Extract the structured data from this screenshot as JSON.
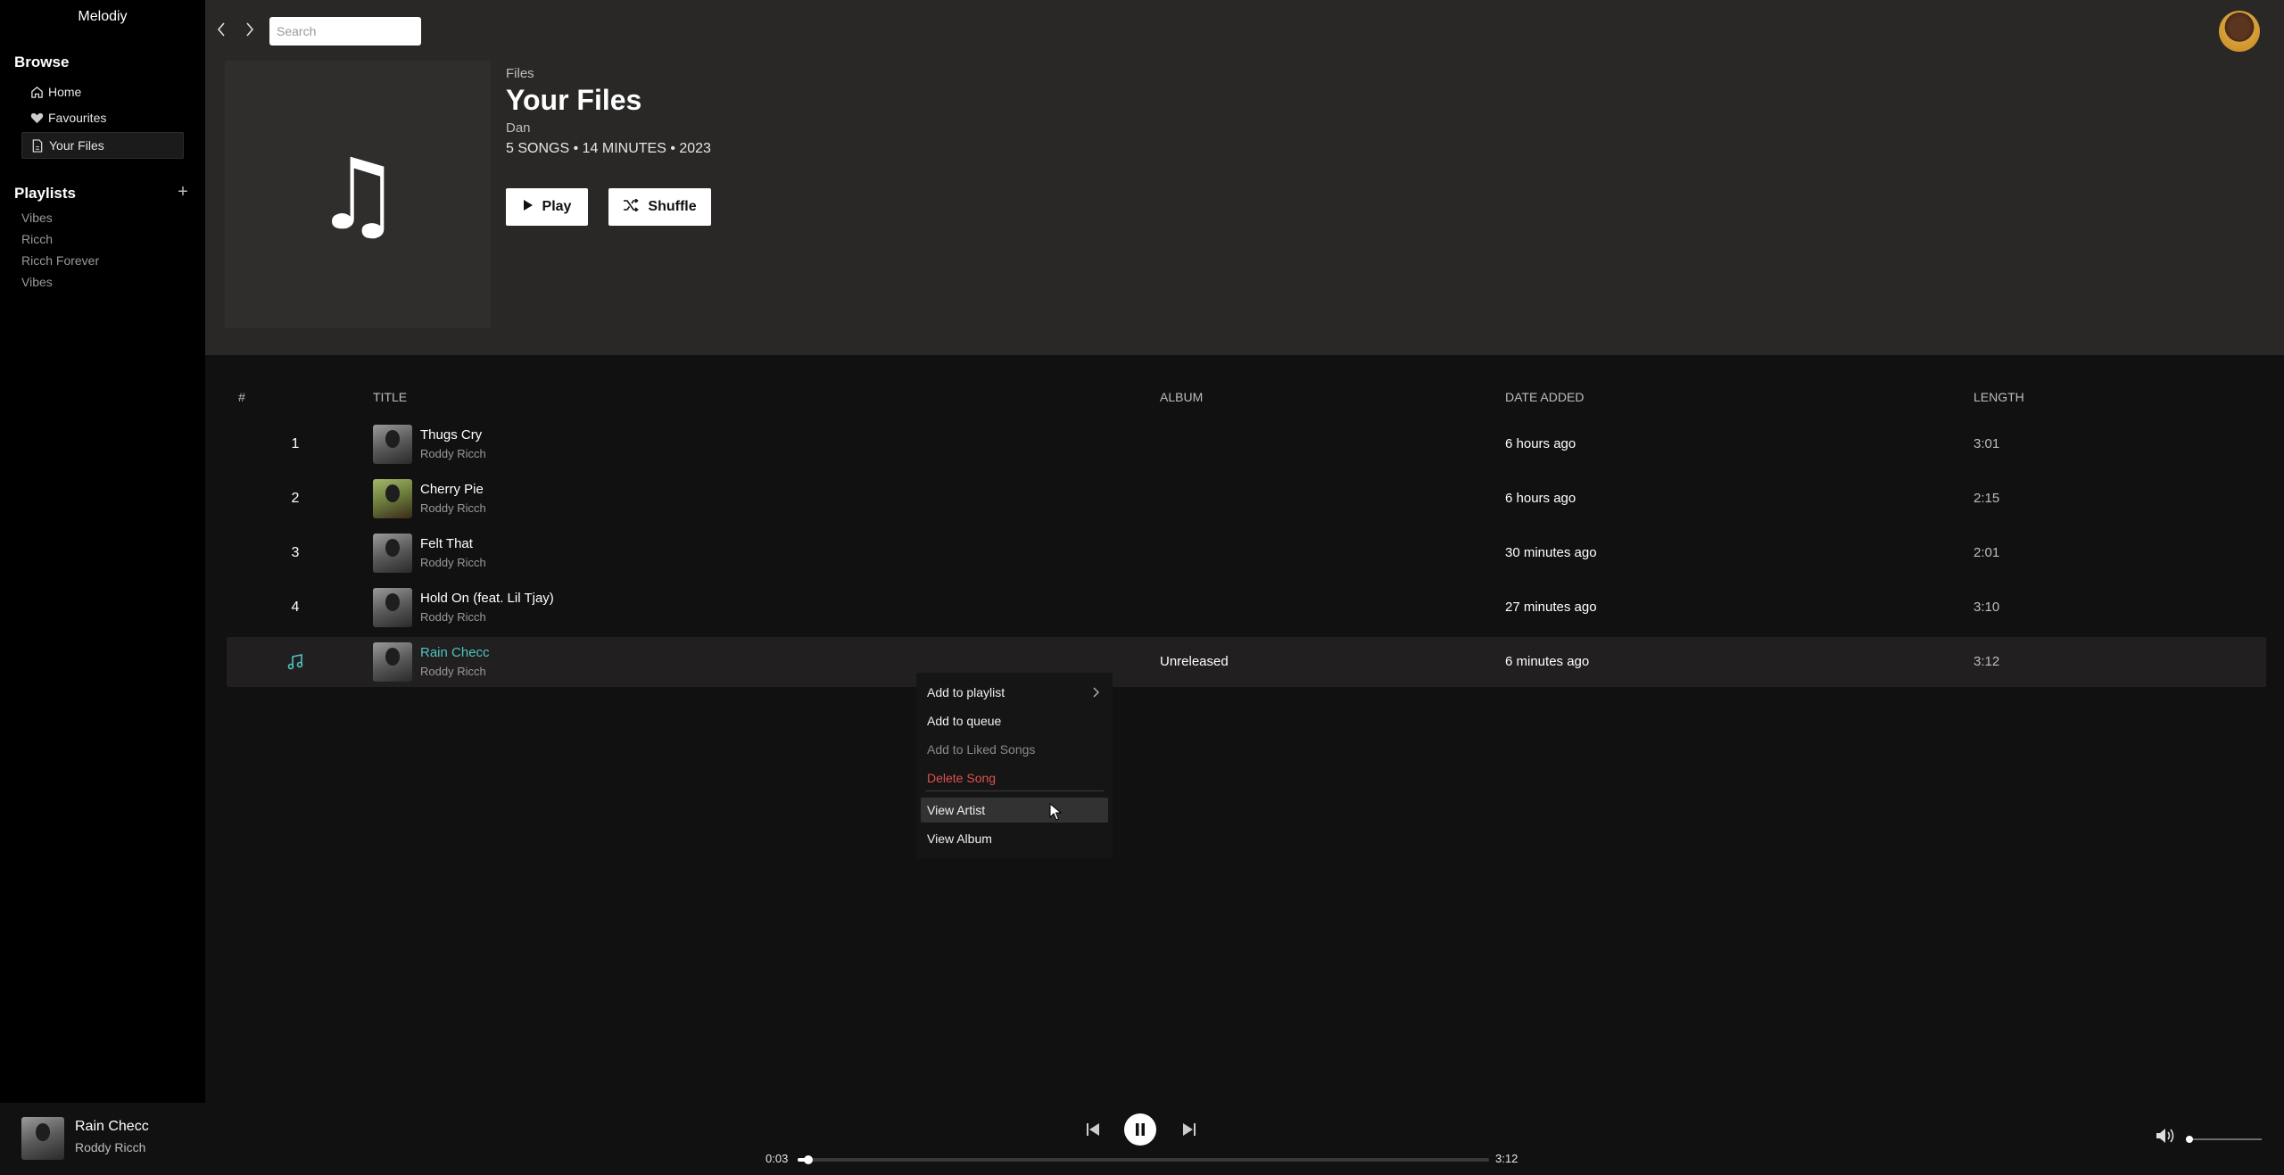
{
  "app": {
    "name": "Melodiy"
  },
  "sidebar": {
    "browse_title": "Browse",
    "browse_items": [
      {
        "label": "Home",
        "icon": "home-icon"
      },
      {
        "label": "Favourites",
        "icon": "heart-icon"
      },
      {
        "label": "Your Files",
        "icon": "file-icon",
        "active": true
      }
    ],
    "playlists_title": "Playlists",
    "add_label": "+",
    "playlists": [
      "Vibes",
      "Ricch",
      "Ricch Forever",
      "Vibes"
    ]
  },
  "topbar": {
    "search_placeholder": "Search"
  },
  "collection": {
    "breadcrumb": "Files",
    "title": "Your Files",
    "owner": "Dan",
    "meta": "5 SONGS • 14 MINUTES • 2023",
    "play_label": "Play",
    "shuffle_label": "Shuffle"
  },
  "table": {
    "headers": {
      "num": "#",
      "title": "TITLE",
      "album": "ALBUM",
      "date": "DATE ADDED",
      "length": "LENGTH"
    },
    "rows": [
      {
        "num": "1",
        "title": "Thugs Cry",
        "artist": "Roddy Ricch",
        "album": "",
        "date": "6 hours ago",
        "length": "3:01"
      },
      {
        "num": "2",
        "title": "Cherry Pie",
        "artist": "Roddy Ricch",
        "album": "",
        "date": "6 hours ago",
        "length": "2:15"
      },
      {
        "num": "3",
        "title": "Felt That",
        "artist": "Roddy Ricch",
        "album": "",
        "date": "30 minutes ago",
        "length": "2:01"
      },
      {
        "num": "4",
        "title": "Hold On (feat. Lil Tjay)",
        "artist": "Roddy Ricch",
        "album": "",
        "date": "27 minutes ago",
        "length": "3:10"
      },
      {
        "num": "",
        "title": "Rain Checc",
        "artist": "Roddy Ricch",
        "album": "Unreleased",
        "date": "6 minutes ago",
        "length": "3:12",
        "playing": true
      }
    ]
  },
  "context_menu": {
    "items": [
      {
        "label": "Add to playlist",
        "submenu": true
      },
      {
        "label": "Add to queue"
      },
      {
        "label": "Add to Liked Songs",
        "disabled": true
      },
      {
        "label": "Delete Song",
        "danger": true
      },
      {
        "label": "View Artist",
        "hovered": true
      },
      {
        "label": "View Album"
      }
    ]
  },
  "player": {
    "title": "Rain Checc",
    "artist": "Roddy Ricch",
    "current_time": "0:03",
    "total_time": "3:12",
    "progress": 0.016,
    "volume": 0.04
  },
  "colors": {
    "accent": "#4fc3c0",
    "danger": "#d9534f",
    "header_bg": "#2a2827"
  }
}
